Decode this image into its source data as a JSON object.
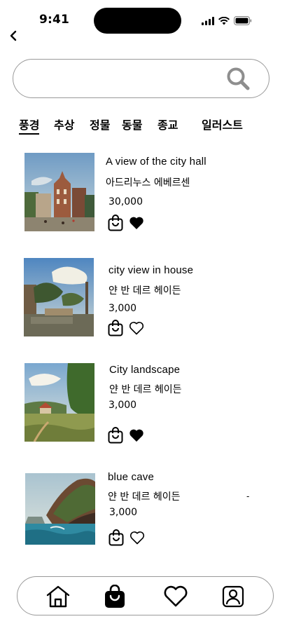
{
  "status_bar": {
    "time": "9:41"
  },
  "search": {
    "value": "",
    "placeholder": ""
  },
  "tabs": [
    {
      "label": "풍경",
      "active": true
    },
    {
      "label": "추상"
    },
    {
      "label": "정물"
    },
    {
      "label": "동물"
    },
    {
      "label": "종교"
    },
    {
      "label": "일러스트"
    }
  ],
  "products": [
    {
      "title": "A view of the city hall",
      "artist": "아드리누스 에베르센",
      "price": "30,000",
      "liked": true,
      "thumb_icon": "city-hall-painting"
    },
    {
      "title": "city view in house",
      "artist": "얀 반 데르 헤이든",
      "price": "3,000",
      "liked": false,
      "thumb_icon": "canal-view-painting"
    },
    {
      "title": "City landscape",
      "artist": "얀 반 데르 헤이든",
      "price": "3,000",
      "liked": true,
      "thumb_icon": "countryside-painting"
    },
    {
      "title": "blue  cave",
      "artist": "얀 반 데르 헤이든",
      "price": "3,000",
      "liked": false,
      "thumb_icon": "coastal-cliff-painting"
    }
  ],
  "stray_mark": "-",
  "bottom_nav": [
    {
      "icon": "home-icon",
      "active": false
    },
    {
      "icon": "shopping-bag-icon",
      "active": true
    },
    {
      "icon": "heart-icon",
      "active": false
    },
    {
      "icon": "profile-icon",
      "active": false
    }
  ]
}
